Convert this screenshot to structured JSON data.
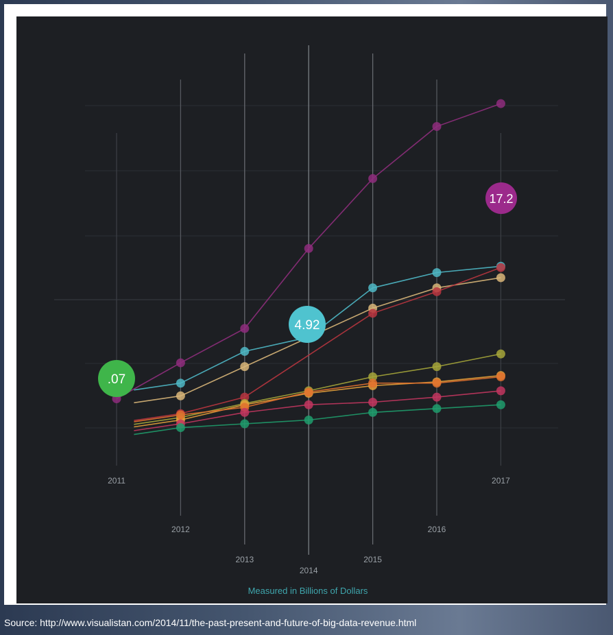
{
  "source": "Source: http://www.visualistan.com/2014/11/the-past-present-and-future-of-big-data-revenue.html",
  "chart_data": {
    "type": "line",
    "title": "",
    "caption": "Measured in Billions of Dollars",
    "x": [
      "2011",
      "2012",
      "2013",
      "2014",
      "2015",
      "2016",
      "2017"
    ],
    "ylim": [
      -6,
      28
    ],
    "grid": true,
    "series": [
      {
        "color": "#8e2d7c",
        "values": [
          0.07,
          2.9,
          5.6,
          11.9,
          17.4,
          21.5,
          23.3
        ]
      },
      {
        "color": "#4fb8c6",
        "values": [
          null,
          1.3,
          3.8,
          4.92,
          8.8,
          10.0,
          10.5
        ]
      },
      {
        "color": "#d9b679",
        "values": [
          null,
          0.3,
          2.6,
          null,
          7.2,
          8.8,
          9.6
        ]
      },
      {
        "color": "#b8353f",
        "values": [
          null,
          -1.1,
          0.2,
          null,
          6.8,
          8.5,
          10.4
        ]
      },
      {
        "color": "#a6a63a",
        "values": [
          null,
          -1.4,
          -0.3,
          0.7,
          1.8,
          2.6,
          3.6
        ]
      },
      {
        "color": "#e6a03a",
        "values": [
          null,
          -1.6,
          -0.4,
          0.5,
          1.1,
          1.4,
          1.9
        ]
      },
      {
        "color": "#e0702e",
        "values": [
          null,
          -1.2,
          -0.6,
          0.6,
          1.3,
          1.3,
          1.8
        ]
      },
      {
        "color": "#c2365f",
        "values": [
          null,
          -1.9,
          -1.0,
          -0.4,
          -0.2,
          0.2,
          0.7
        ]
      },
      {
        "color": "#1f9c6c",
        "values": [
          null,
          -2.2,
          -1.9,
          -1.6,
          -1.0,
          -0.7,
          -0.4
        ]
      }
    ],
    "callouts": [
      {
        "label": ".07",
        "color": "#3fb54a",
        "series": 8,
        "index": 0
      },
      {
        "label": "4.92",
        "color": "#4fc3cf",
        "series": 1,
        "index": 3
      },
      {
        "label": "17.2",
        "color": "#9b2a8b",
        "series": 0,
        "index": 6
      }
    ]
  }
}
